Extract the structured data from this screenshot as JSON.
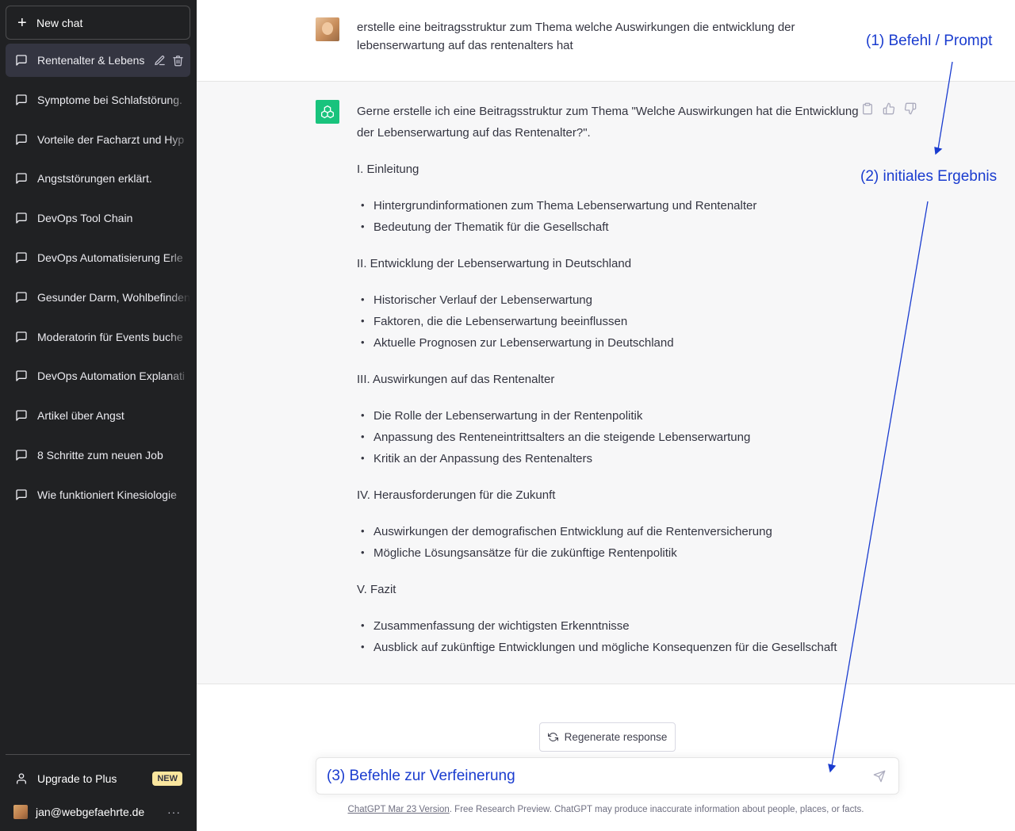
{
  "sidebar": {
    "new_chat_label": "New chat",
    "items": [
      {
        "label": "Rentenalter & Lebenser"
      },
      {
        "label": "Symptome bei Schlafstörung."
      },
      {
        "label": "Vorteile der Facharzt und Hyp"
      },
      {
        "label": "Angststörungen erklärt."
      },
      {
        "label": "DevOps Tool Chain"
      },
      {
        "label": "DevOps Automatisierung Erle"
      },
      {
        "label": "Gesunder Darm, Wohlbefinden"
      },
      {
        "label": "Moderatorin für Events buche"
      },
      {
        "label": "DevOps Automation Explanati"
      },
      {
        "label": "Artikel über Angst"
      },
      {
        "label": "8 Schritte zum neuen Job"
      },
      {
        "label": "Wie funktioniert Kinesiologie"
      }
    ],
    "upgrade_label": "Upgrade to Plus",
    "upgrade_badge": "NEW",
    "user_email": "jan@webgefaehrte.de",
    "more_label": "···"
  },
  "conversation": {
    "user_message": "erstelle eine beitragsstruktur zum Thema welche Auswirkungen die entwicklung der lebenserwartung auf das rentenalters hat",
    "assistant_intro": "Gerne erstelle ich eine Beitragsstruktur zum Thema \"Welche Auswirkungen hat die Entwicklung der Lebenserwartung auf das Rentenalter?\".",
    "sections": [
      {
        "heading": "I. Einleitung",
        "bullets": [
          "Hintergrundinformationen zum Thema Lebenserwartung und Rentenalter",
          "Bedeutung der Thematik für die Gesellschaft"
        ]
      },
      {
        "heading": "II. Entwicklung der Lebenserwartung in Deutschland",
        "bullets": [
          "Historischer Verlauf der Lebenserwartung",
          "Faktoren, die die Lebenserwartung beeinflussen",
          "Aktuelle Prognosen zur Lebenserwartung in Deutschland"
        ]
      },
      {
        "heading": "III. Auswirkungen auf das Rentenalter",
        "bullets": [
          "Die Rolle der Lebenserwartung in der Rentenpolitik",
          "Anpassung des Renteneintrittsalters an die steigende Lebenserwartung",
          "Kritik an der Anpassung des Rentenalters"
        ]
      },
      {
        "heading": "IV. Herausforderungen für die Zukunft",
        "bullets": [
          "Auswirkungen der demografischen Entwicklung auf die Rentenversicherung",
          "Mögliche Lösungsansätze für die zukünftige Rentenpolitik"
        ]
      },
      {
        "heading": "V. Fazit",
        "bullets": [
          "Zusammenfassung der wichtigsten Erkenntnisse",
          "Ausblick auf zukünftige Entwicklungen und mögliche Konsequenzen für die Gesellschaft"
        ]
      }
    ]
  },
  "regenerate_label": "Regenerate response",
  "input": {
    "value": "(3) Befehle zur Verfeinerung"
  },
  "footer": {
    "version_link": "ChatGPT Mar 23 Version",
    "text": ". Free Research Preview. ChatGPT may produce inaccurate information about people, places, or facts."
  },
  "annotations": {
    "a1": "(1) Befehl / Prompt",
    "a2": "(2) initiales Ergebnis"
  },
  "colors": {
    "sidebar_bg": "#202123",
    "assistant_bg": "#f7f7f8",
    "gpt_green": "#19c37d",
    "annotation_blue": "#1a3ccf",
    "badge_yellow": "#fae69e"
  }
}
